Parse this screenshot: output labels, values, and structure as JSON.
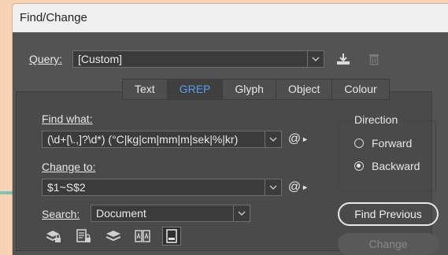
{
  "window": {
    "title": "Find/Change"
  },
  "query": {
    "label": "Query:",
    "value": "[Custom]"
  },
  "tabs": [
    {
      "label": "Text"
    },
    {
      "label": "GREP"
    },
    {
      "label": "Glyph"
    },
    {
      "label": "Object"
    },
    {
      "label": "Colour"
    }
  ],
  "find": {
    "label": "Find what:",
    "value": "(\\d+[\\.,]?\\d*) (°C|kg|cm|mm|m|sek|%|kr)"
  },
  "change": {
    "label": "Change to:",
    "value": "$1~S$2"
  },
  "search": {
    "label": "Search:",
    "value": "Document"
  },
  "special_char_glyph": "@",
  "direction": {
    "label": "Direction",
    "options": [
      {
        "label": "Forward",
        "selected": false
      },
      {
        "label": "Backward",
        "selected": true
      }
    ]
  },
  "buttons": {
    "find_previous": "Find Previous",
    "change": "Change"
  },
  "colors": {
    "accent": "#5a9cf0",
    "dialog_bg": "#535353",
    "page_bg": "#f7d2b5"
  }
}
